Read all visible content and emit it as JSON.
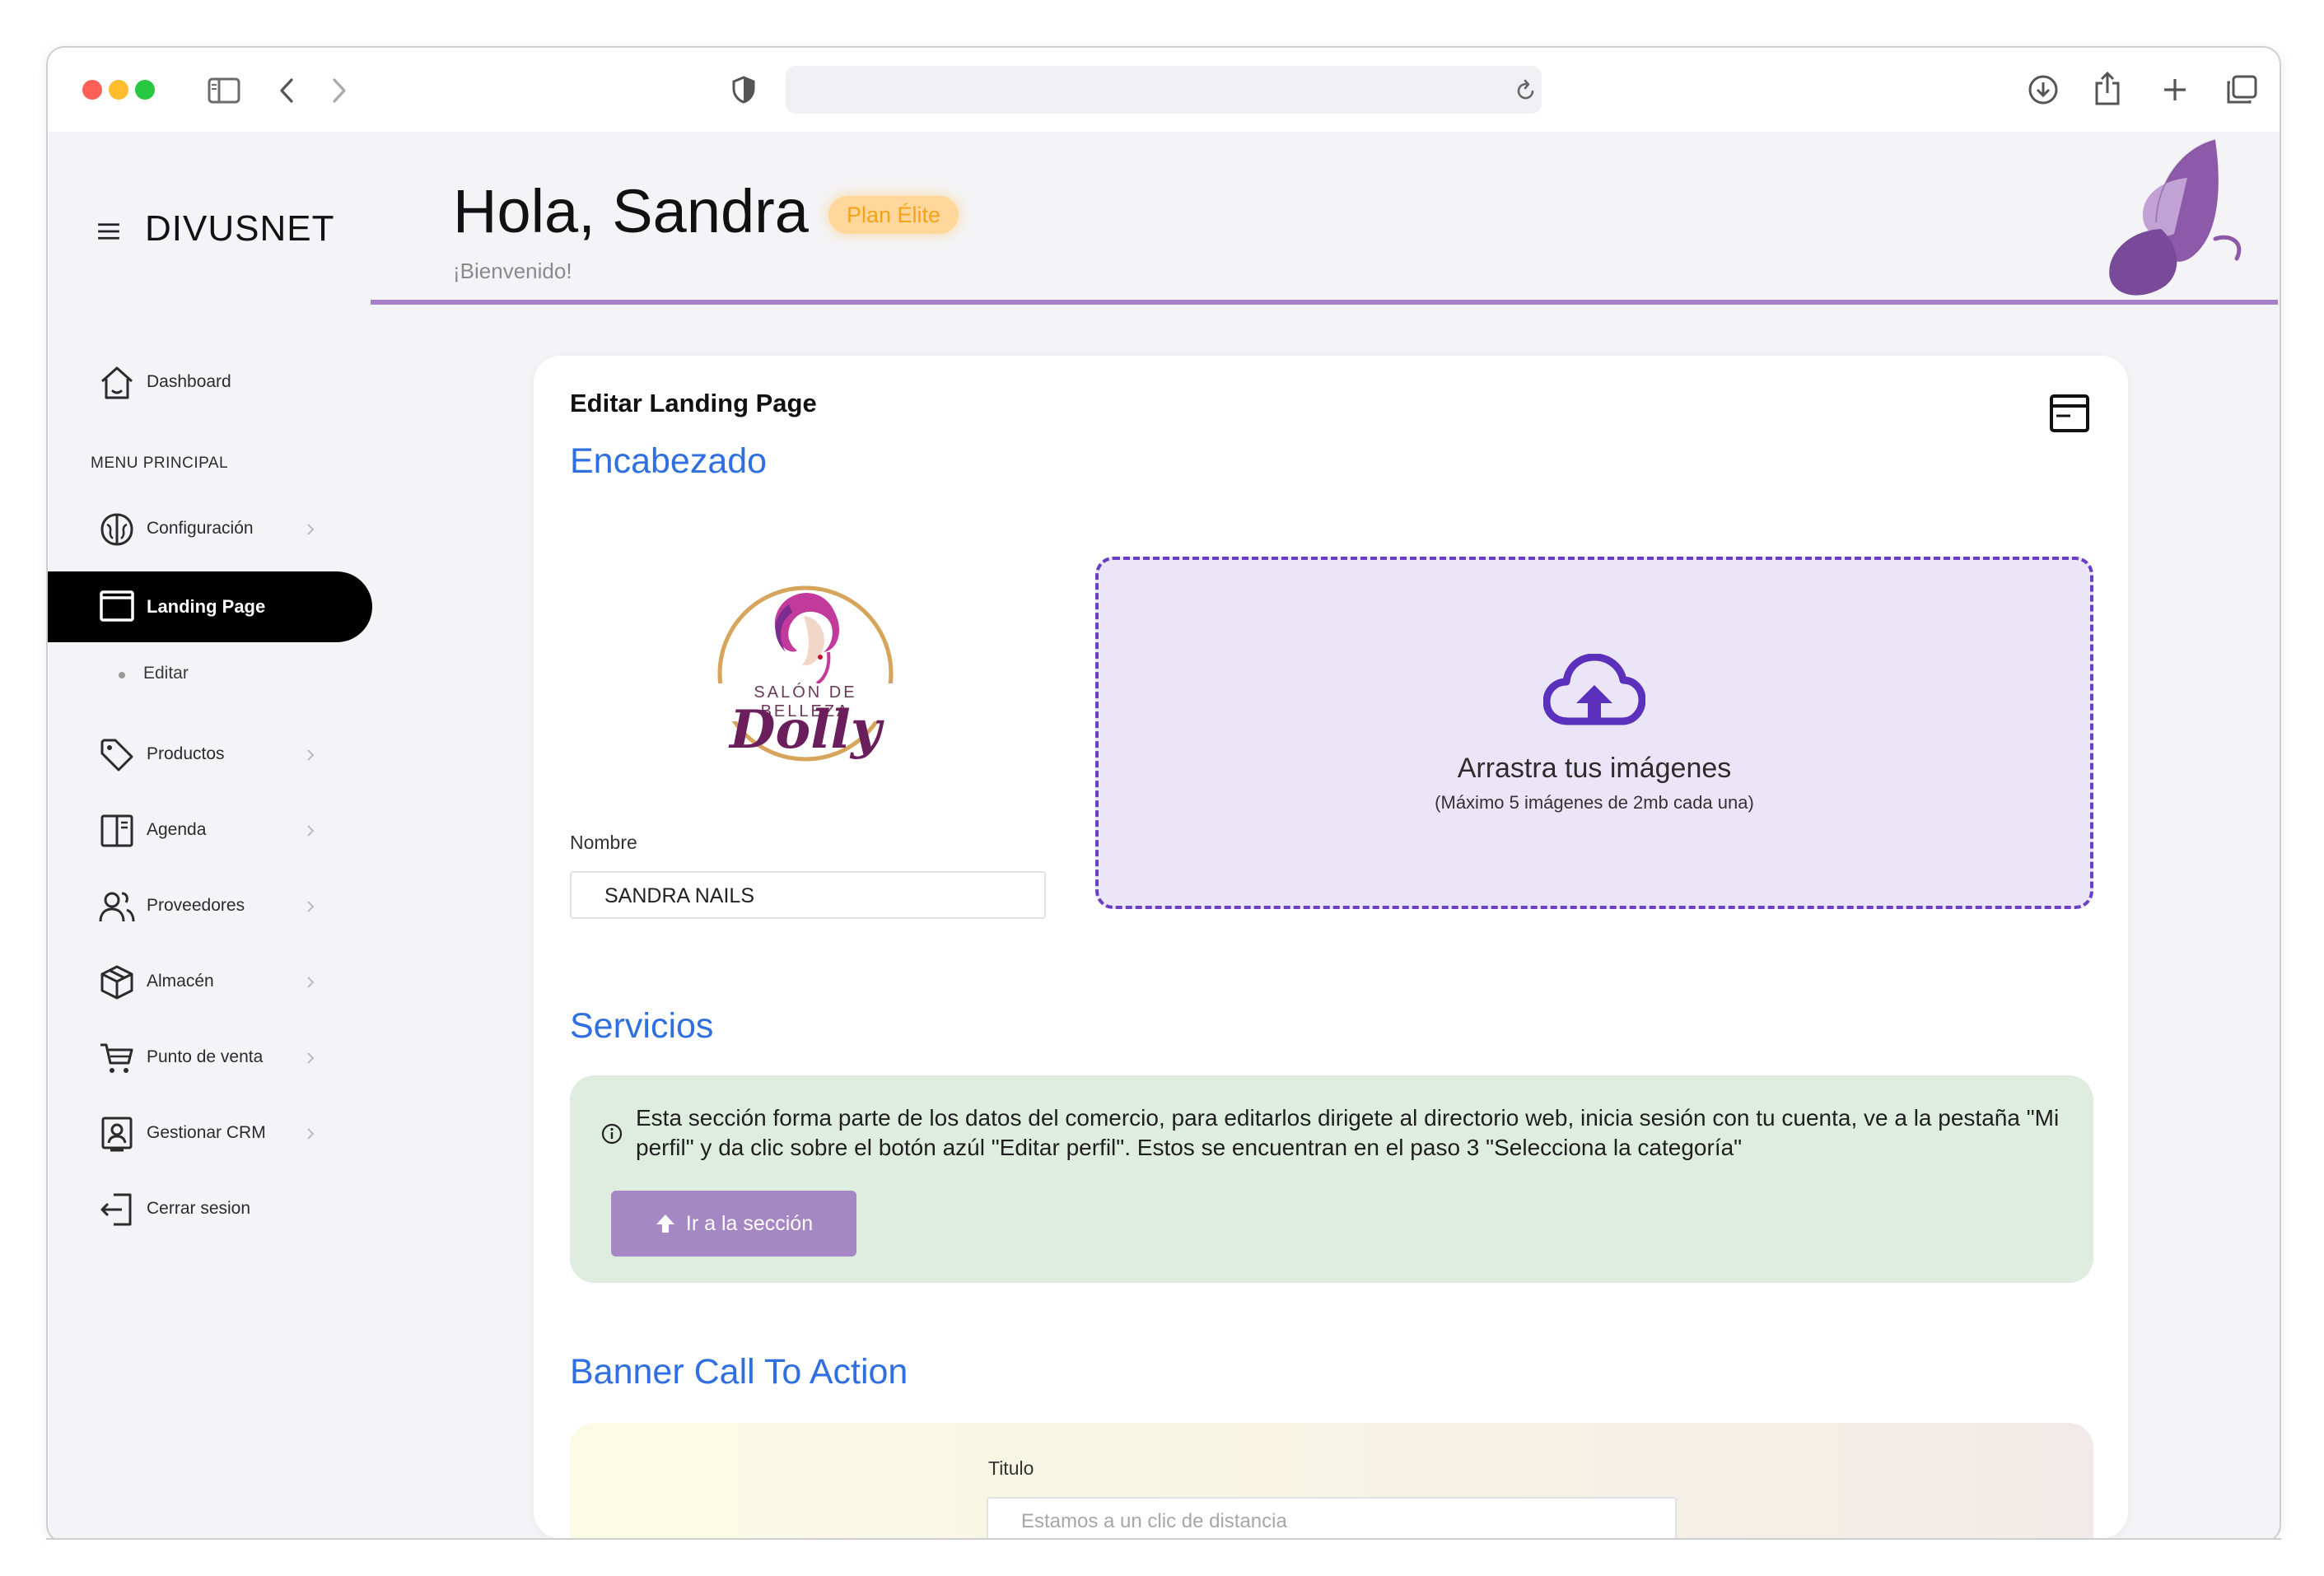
{
  "browser": {
    "url": ""
  },
  "sidebar": {
    "brand": "DIVUSNET",
    "dashboard": "Dashboard",
    "section_label": "MENU PRINCIPAL",
    "items": [
      {
        "label": "Configuración",
        "icon": "brain-icon"
      },
      {
        "label": "Landing Page",
        "icon": "window-icon",
        "active": true
      },
      {
        "label": "Productos",
        "icon": "tag-icon"
      },
      {
        "label": "Agenda",
        "icon": "book-icon"
      },
      {
        "label": "Proveedores",
        "icon": "users-icon"
      },
      {
        "label": "Almacén",
        "icon": "box-icon"
      },
      {
        "label": "Punto de venta",
        "icon": "cart-icon"
      },
      {
        "label": "Gestionar CRM",
        "icon": "contact-card-icon"
      },
      {
        "label": "Cerrar sesion",
        "icon": "logout-icon"
      }
    ],
    "sub_item": "Editar"
  },
  "header": {
    "greeting": "Hola, Sandra",
    "plan_badge": "Plan Élite",
    "welcome": "¡Bienvenido!",
    "accent_color": "#a580c6"
  },
  "card": {
    "title": "Editar Landing Page",
    "encabezado": {
      "heading": "Encabezado",
      "logo_text": [
        "SALÓN DE BELLEZA",
        "Dolly"
      ],
      "name_label": "Nombre",
      "name_value": "SANDRA NAILS",
      "dropzone_title": "Arrastra tus imágenes",
      "dropzone_sub": "(Máximo 5 imágenes de 2mb cada una)"
    },
    "servicios": {
      "heading": "Servicios",
      "info": "Esta sección forma parte de los datos del comercio, para editarlos dirigete al directorio web, inicia sesión con tu cuenta, ve a la pestaña \"Mi perfil\" y da clic sobre el botón azúl \"Editar perfil\". Estos se encuentran en el paso 3 \"Selecciona la categoría\"",
      "button": "Ir a la sección"
    },
    "banner": {
      "heading": "Banner Call To Action",
      "title_label": "Titulo",
      "title_placeholder": "Estamos a un clic de distancia"
    }
  },
  "colors": {
    "link_blue": "#2f6fe0",
    "dropzone_border": "#6a3fc6",
    "alert_bg": "#dfede0",
    "button_purple": "#a587c4",
    "badge_text": "#f5a21b"
  }
}
